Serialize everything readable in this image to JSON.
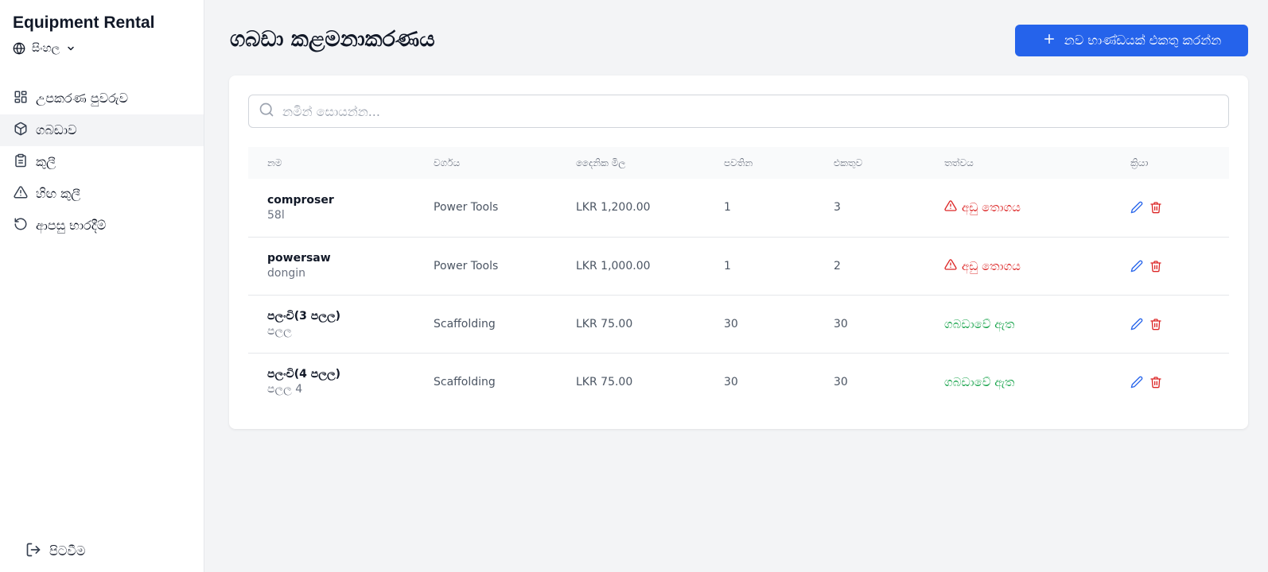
{
  "app": {
    "brand": "Equipment Rental",
    "language": "සිංහල"
  },
  "sidebar": {
    "items": [
      {
        "label": "උපකරණ පුවරුව",
        "icon": "dashboard-icon"
      },
      {
        "label": "ගබඩාව",
        "icon": "package-icon"
      },
      {
        "label": "කුලී",
        "icon": "clipboard-icon"
      },
      {
        "label": "හිඟ කුලී",
        "icon": "alert-triangle-icon"
      },
      {
        "label": "ආපසු භාරදීම්",
        "icon": "rotate-ccw-icon"
      }
    ],
    "active_index": 1,
    "logout_label": "පිටවීම"
  },
  "header": {
    "title": "ගබඩා කළමනාකරණය",
    "add_button_label": "නව භාණ්ඩයක් එකතු කරන්න"
  },
  "search": {
    "placeholder": "නමින් සොයන්න...",
    "value": ""
  },
  "table": {
    "columns": [
      "නම",
      "වර්ගය",
      "දෛනික මිල",
      "පවතින",
      "එකතුව",
      "තත්වය",
      "ක්‍රියා"
    ],
    "rows": [
      {
        "name": "comproser",
        "sub": "58l",
        "category": "Power Tools",
        "price": "LKR 1,200.00",
        "available": "1",
        "total": "3",
        "status": "අඩු තොගය",
        "status_type": "low"
      },
      {
        "name": "powersaw",
        "sub": "dongin",
        "category": "Power Tools",
        "price": "LKR 1,000.00",
        "available": "1",
        "total": "2",
        "status": "අඩු තොගය",
        "status_type": "low"
      },
      {
        "name": "පලංචි(3 පලල)",
        "sub": "පලල",
        "category": "Scaffolding",
        "price": "LKR 75.00",
        "available": "30",
        "total": "30",
        "status": "ගබඩාවේ ඇත",
        "status_type": "ok"
      },
      {
        "name": "පලංචි(4 පලල)",
        "sub": "පලල 4",
        "category": "Scaffolding",
        "price": "LKR 75.00",
        "available": "30",
        "total": "30",
        "status": "ගබඩාවේ ඇත",
        "status_type": "ok"
      }
    ]
  },
  "colors": {
    "primary": "#2563eb",
    "danger": "#dc2626",
    "success": "#16a34a",
    "edit": "#2563eb"
  }
}
